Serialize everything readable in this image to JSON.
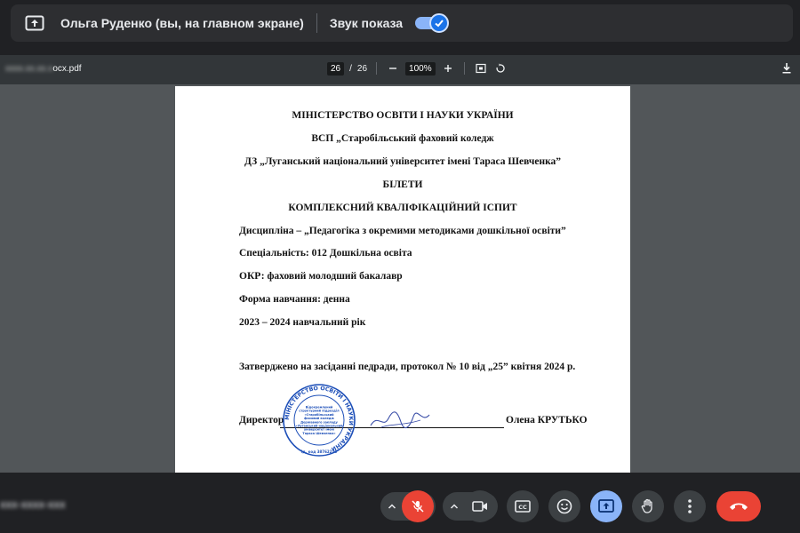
{
  "banner": {
    "presenter_text": "Ольга Руденко (вы, на главном экране)",
    "sound_label": "Звук показа",
    "sound_enabled": true,
    "present_icon": "present-to-all-icon",
    "toggle_color": "#8ab4f8"
  },
  "pdf": {
    "filename_blurred": "xxxx.xx.xx.x",
    "filename_visible": "ocx.pdf",
    "current_page": "26",
    "page_sep": "/",
    "total_pages": "26",
    "zoom": "100%",
    "icons": [
      "minus-icon",
      "plus-icon",
      "fit-page-icon",
      "rotate-icon",
      "download-icon"
    ]
  },
  "document": {
    "line1": "МІНІСТЕРСТВО ОСВІТИ І НАУКИ УКРАЇНИ",
    "line2": "ВСП „Старобільський фаховий коледж",
    "line3": "ДЗ „Луганський національний університет імені Тараса Шевченка”",
    "line4": "БІЛЕТИ",
    "line5": "КОМПЛЕКСНИЙ КВАЛІФІКАЦІЙНИЙ ІСПИТ",
    "discipline": "Дисципліна  – „Педагогіка з окремими методиками дошкільної освіти”",
    "specialty": "Спеціальність: 012 Дошкільна освіта",
    "okr": "ОКР: фаховий молодший бакалавр",
    "study_form": "Форма навчання: денна",
    "year": "2023 – 2024 навчальний рік",
    "approved": "Затверджено на засіданні педради, протокол № 10  від „25” квітня 2024 р.",
    "director_label": "Директор",
    "director_name": "Олена КРУТЬКО"
  },
  "stamp": {
    "ring_text": "МІНІСТЕРСТВО ОСВІТИ І НАУКИ УКРАЇНИ",
    "center_lines": [
      "Відокремлений",
      "структурний підрозділ",
      "«Старобільський",
      "фаховий коледж",
      "Державного закладу",
      "«Луганський національний",
      "університет імені",
      "Тараса Шевченка»"
    ],
    "code": "Ід. код 38762278",
    "color": "#1d4fb8"
  },
  "bottom": {
    "meeting_code_blurred": "xxx-xxxx-xxx",
    "controls": [
      "mic-off-button",
      "camera-button",
      "captions-button",
      "emoji-button",
      "present-button",
      "raise-hand-button",
      "more-options-button",
      "leave-call-button"
    ],
    "mic_color": "#ea4335",
    "present_color": "#8ab4f8",
    "leave_color": "#ea4335"
  }
}
